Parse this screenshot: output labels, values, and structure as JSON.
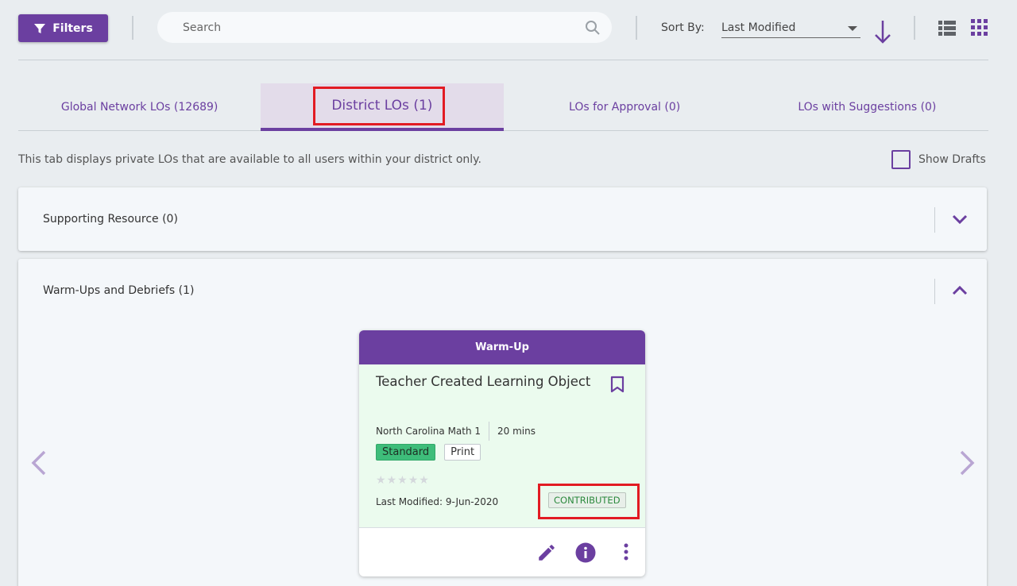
{
  "toolbar": {
    "filters_label": "Filters",
    "search_placeholder": "Search",
    "sort_label": "Sort By:",
    "sort_value": "Last Modified"
  },
  "tabs": [
    {
      "label": "Global Network LOs (12689)",
      "active": false
    },
    {
      "label": "District LOs (1)",
      "active": true
    },
    {
      "label": "LOs for Approval (0)",
      "active": false
    },
    {
      "label": "LOs with Suggestions (0)",
      "active": false
    }
  ],
  "info_text": "This tab displays private LOs that are available to all users within your district only.",
  "show_drafts_label": "Show Drafts",
  "sections": [
    {
      "title": "Supporting Resource (0)",
      "expanded": false
    },
    {
      "title": "Warm-Ups and Debriefs (1)",
      "expanded": true
    }
  ],
  "card": {
    "type": "Warm-Up",
    "title": "Teacher Created Learning Object",
    "course": "North Carolina Math 1",
    "duration": "20 mins",
    "tags": [
      "Standard",
      "Print"
    ],
    "rating": 0,
    "rating_max": 5,
    "last_modified": "Last Modified: 9-Jun-2020",
    "status": "CONTRIBUTED"
  },
  "icons": {
    "filter": "filter-icon",
    "search": "search-icon",
    "sort_direction": "arrow-down-icon",
    "list_view": "list-view-icon",
    "grid_view": "grid-view-icon",
    "bookmark": "bookmark-icon",
    "edit": "pencil-icon",
    "info": "info-icon",
    "more": "more-vertical-icon"
  },
  "colors": {
    "brand": "#6b3fa0",
    "highlight": "#e21b23",
    "card_body": "#ebfbee",
    "standard_tag": "#3ebd7a"
  }
}
